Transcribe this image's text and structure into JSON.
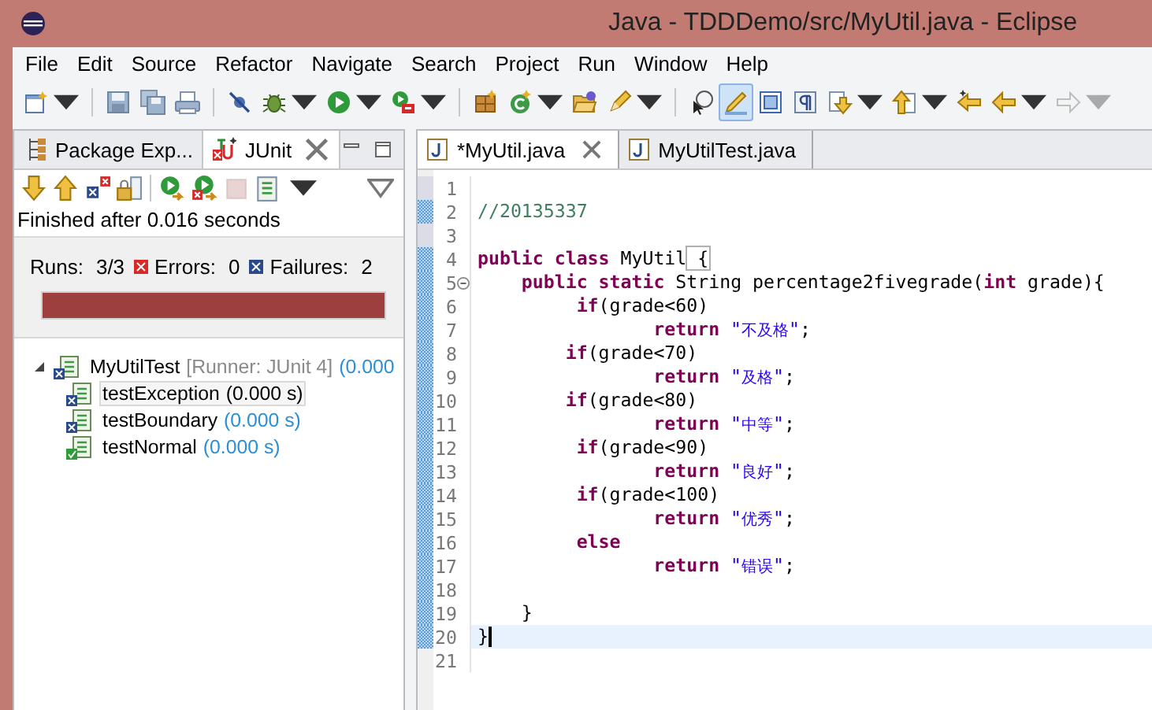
{
  "window": {
    "title": "Java - TDDDemo/src/MyUtil.java - Eclipse"
  },
  "menu": [
    "File",
    "Edit",
    "Source",
    "Refactor",
    "Navigate",
    "Search",
    "Project",
    "Run",
    "Window",
    "Help"
  ],
  "toolbar": [
    {
      "kind": "new",
      "dropdown": true,
      "selected": false
    },
    {
      "kind": "separator"
    },
    {
      "kind": "save",
      "dropdown": false,
      "selected": false
    },
    {
      "kind": "save-all",
      "dropdown": false,
      "selected": false
    },
    {
      "kind": "print",
      "dropdown": false,
      "selected": false
    },
    {
      "kind": "separator"
    },
    {
      "kind": "skip-breakpoints",
      "dropdown": false,
      "selected": false
    },
    {
      "kind": "debug",
      "dropdown": true,
      "selected": false
    },
    {
      "kind": "run",
      "dropdown": true,
      "selected": false
    },
    {
      "kind": "run-external",
      "dropdown": true,
      "selected": false
    },
    {
      "kind": "separator"
    },
    {
      "kind": "new-package",
      "dropdown": false,
      "selected": false
    },
    {
      "kind": "new-class",
      "dropdown": true,
      "selected": false
    },
    {
      "kind": "open-folder",
      "dropdown": false,
      "selected": false
    },
    {
      "kind": "pencil",
      "dropdown": true,
      "selected": false
    },
    {
      "kind": "separator"
    },
    {
      "kind": "open-task",
      "dropdown": false,
      "selected": false
    },
    {
      "kind": "highlight",
      "dropdown": false,
      "selected": true
    },
    {
      "kind": "block-select",
      "dropdown": false,
      "selected": false
    },
    {
      "kind": "whitespace",
      "dropdown": false,
      "selected": false
    },
    {
      "kind": "next-annotation",
      "dropdown": true,
      "selected": false
    },
    {
      "kind": "prev-annotation",
      "dropdown": true,
      "selected": false
    },
    {
      "kind": "last-edit",
      "dropdown": false,
      "selected": false
    },
    {
      "kind": "back",
      "dropdown": true,
      "selected": false
    },
    {
      "kind": "forward",
      "dropdown": true,
      "selected": false,
      "disabled": true
    }
  ],
  "left_view": {
    "tabs": [
      {
        "label": "Package Exp...",
        "kind": "package",
        "selected": false
      },
      {
        "label": "JUnit",
        "kind": "junit",
        "selected": true
      }
    ],
    "toolbar": [
      {
        "kind": "next-failure"
      },
      {
        "kind": "prev-failure"
      },
      {
        "kind": "failures-only"
      },
      {
        "kind": "scroll-lock"
      },
      {
        "kind": "separator"
      },
      {
        "kind": "rerun"
      },
      {
        "kind": "rerun-failed"
      },
      {
        "kind": "stop",
        "disabled": true
      },
      {
        "kind": "history"
      }
    ],
    "status": "Finished after 0.016 seconds",
    "counters": [
      {
        "kind": "runs",
        "label": "Runs:",
        "value": "3/3"
      },
      {
        "kind": "errors",
        "label": "Errors:",
        "value": "0"
      },
      {
        "kind": "failures",
        "label": "Failures:",
        "value": "2"
      }
    ],
    "progress": {
      "level": 1,
      "failed": true
    },
    "tree": [
      {
        "name": "MyUtilTest",
        "runner": "[Runner: JUnit 4]",
        "time": "(0.000",
        "passed": false,
        "expanded": true,
        "selected": false,
        "children": [
          {
            "name": "testException",
            "time": "(0.000 s)",
            "passed": false,
            "selected": true
          },
          {
            "name": "testBoundary",
            "time": "(0.000 s)",
            "passed": false,
            "selected": false
          },
          {
            "name": "testNormal",
            "time": "(0.000 s)",
            "passed": true,
            "selected": false
          }
        ]
      }
    ]
  },
  "editor": {
    "tabs": [
      {
        "label": "*MyUtil.java",
        "selected": true
      },
      {
        "label": "MyUtilTest.java",
        "selected": false
      }
    ],
    "lines": [
      {
        "number": "1",
        "modified": true,
        "added": false
      },
      {
        "number": "2",
        "modified": false,
        "added": true,
        "tokens": [
          {
            "kind": "comment",
            "text": "//20135337"
          }
        ]
      },
      {
        "number": "3",
        "modified": true,
        "added": false
      },
      {
        "number": "4",
        "modified": false,
        "added": true,
        "tokens": [
          {
            "kind": "keyword",
            "text": "public"
          },
          {
            "kind": "keyword",
            "text": " class"
          },
          {
            "kind": "plain",
            "text": " MyUtil"
          },
          {
            "kind": "match",
            "text": " {"
          }
        ]
      },
      {
        "number": "5",
        "modified": false,
        "added": true,
        "fold": true,
        "tokens": [
          {
            "kind": "keyword",
            "text": "    public"
          },
          {
            "kind": "keyword",
            "text": " static"
          },
          {
            "kind": "plain",
            "text": " String percentage2fivegrade("
          },
          {
            "kind": "keyword",
            "text": "int"
          },
          {
            "kind": "plain",
            "text": " grade){"
          }
        ]
      },
      {
        "number": "6",
        "modified": false,
        "added": true,
        "tokens": [
          {
            "kind": "keyword",
            "text": "         if"
          },
          {
            "kind": "plain",
            "text": "(grade<60)"
          }
        ]
      },
      {
        "number": "7",
        "modified": false,
        "added": true,
        "tokens": [
          {
            "kind": "keyword",
            "text": "                return"
          },
          {
            "kind": "string",
            "text": " \"不及格\""
          },
          {
            "kind": "plain",
            "text": ";"
          }
        ]
      },
      {
        "number": "8",
        "modified": false,
        "added": true,
        "tokens": [
          {
            "kind": "keyword",
            "text": "        if"
          },
          {
            "kind": "plain",
            "text": "(grade<70)"
          }
        ]
      },
      {
        "number": "9",
        "modified": false,
        "added": true,
        "tokens": [
          {
            "kind": "keyword",
            "text": "                return"
          },
          {
            "kind": "string",
            "text": " \"及格\""
          },
          {
            "kind": "plain",
            "text": ";"
          }
        ]
      },
      {
        "number": "10",
        "modified": false,
        "added": true,
        "tokens": [
          {
            "kind": "keyword",
            "text": "        if"
          },
          {
            "kind": "plain",
            "text": "(grade<80)"
          }
        ]
      },
      {
        "number": "11",
        "modified": false,
        "added": true,
        "tokens": [
          {
            "kind": "keyword",
            "text": "                return"
          },
          {
            "kind": "string",
            "text": " \"中等\""
          },
          {
            "kind": "plain",
            "text": ";"
          }
        ]
      },
      {
        "number": "12",
        "modified": false,
        "added": true,
        "tokens": [
          {
            "kind": "keyword",
            "text": "         if"
          },
          {
            "kind": "plain",
            "text": "(grade<90)"
          }
        ]
      },
      {
        "number": "13",
        "modified": false,
        "added": true,
        "tokens": [
          {
            "kind": "keyword",
            "text": "                return"
          },
          {
            "kind": "string",
            "text": " \"良好\""
          },
          {
            "kind": "plain",
            "text": ";"
          }
        ]
      },
      {
        "number": "14",
        "modified": false,
        "added": true,
        "tokens": [
          {
            "kind": "keyword",
            "text": "         if"
          },
          {
            "kind": "plain",
            "text": "(grade<100)"
          }
        ]
      },
      {
        "number": "15",
        "modified": false,
        "added": true,
        "tokens": [
          {
            "kind": "keyword",
            "text": "                return"
          },
          {
            "kind": "string",
            "text": " \"优秀\""
          },
          {
            "kind": "plain",
            "text": ";"
          }
        ]
      },
      {
        "number": "16",
        "modified": false,
        "added": true,
        "tokens": [
          {
            "kind": "keyword",
            "text": "         else"
          }
        ]
      },
      {
        "number": "17",
        "modified": false,
        "added": true,
        "tokens": [
          {
            "kind": "keyword",
            "text": "                return"
          },
          {
            "kind": "string",
            "text": " \"错误\""
          },
          {
            "kind": "plain",
            "text": ";"
          }
        ]
      },
      {
        "number": "18",
        "modified": false,
        "added": true
      },
      {
        "number": "19",
        "modified": false,
        "added": true,
        "tokens": [
          {
            "kind": "plain",
            "text": "    }"
          }
        ]
      },
      {
        "number": "20",
        "modified": false,
        "added": true,
        "current": true,
        "tokens": [
          {
            "kind": "plain",
            "text": "}"
          }
        ]
      },
      {
        "number": "21",
        "modified": false,
        "added": false
      }
    ]
  }
}
